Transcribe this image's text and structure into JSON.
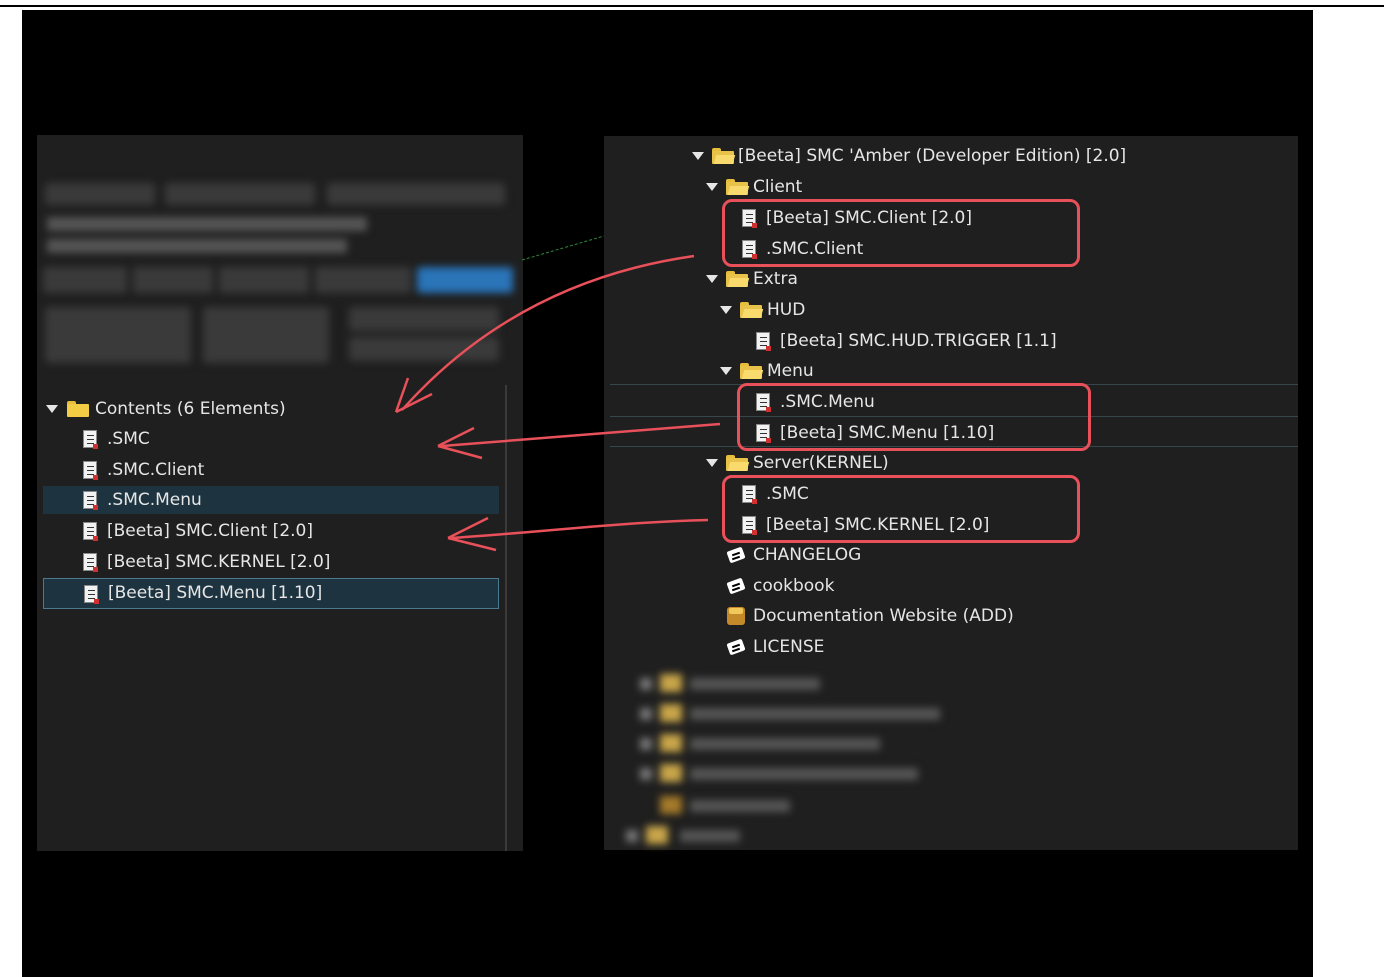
{
  "left_panel": {
    "header": "Contents (6 Elements)",
    "items": [
      ".SMC",
      ".SMC.Client",
      ".SMC.Menu",
      "[Beeta] SMC.Client [2.0]",
      "[Beeta] SMC.KERNEL [2.0]",
      "[Beeta] SMC.Menu [1.10]"
    ]
  },
  "right_panel": {
    "root": "[Beeta] SMC 'Amber (Developer Edition) [2.0]",
    "client_folder": "Client",
    "client_items": [
      "[Beeta] SMC.Client [2.0]",
      ".SMC.Client"
    ],
    "extra_folder": "Extra",
    "hud_folder": "HUD",
    "hud_item": "[Beeta] SMC.HUD.TRIGGER [1.1]",
    "menu_folder": "Menu",
    "menu_items": [
      ".SMC.Menu",
      "[Beeta] SMC.Menu [1.10]"
    ],
    "server_folder": "Server(KERNEL)",
    "server_items": [
      ".SMC",
      "[Beeta] SMC.KERNEL [2.0]"
    ],
    "notes": [
      "CHANGELOG",
      "cookbook"
    ],
    "docs": "Documentation Website (ADD)",
    "license": "LICENSE"
  },
  "colors": {
    "highlight": "#e8505a",
    "selection": "#1d3440",
    "panel": "#1f1f1f"
  }
}
